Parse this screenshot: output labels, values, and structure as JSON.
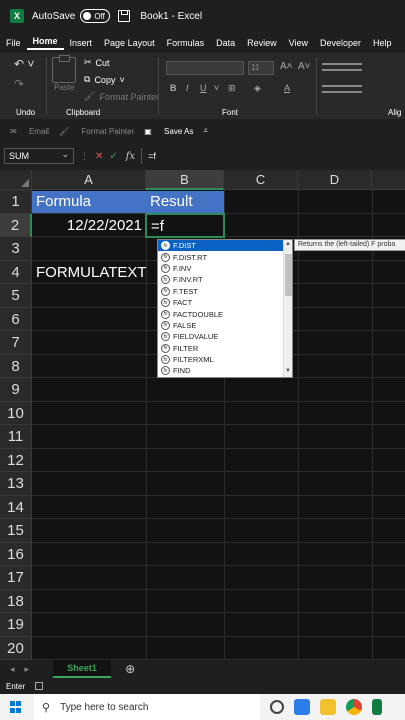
{
  "titlebar": {
    "autosave_label": "AutoSave",
    "toggle_state": "Off",
    "title": "Book1 - Excel"
  },
  "menu": [
    "File",
    "Home",
    "Insert",
    "Page Layout",
    "Formulas",
    "Data",
    "Review",
    "View",
    "Developer",
    "Help"
  ],
  "ribbon": {
    "cut": "Cut",
    "copy": "Copy",
    "format_painter": "Format Painter",
    "paste": "Paste",
    "font_size": "11",
    "groups": {
      "undo": "Undo",
      "clipboard": "Clipboard",
      "font": "Font",
      "alignment": "Alig"
    }
  },
  "quickbar": {
    "email": "Email",
    "format_painter": "Format Painter",
    "save_as": "Save As"
  },
  "formula_bar": {
    "name_box": "SUM",
    "formula": "=f",
    "fx": "fx"
  },
  "columns": [
    "A",
    "B",
    "C",
    "D"
  ],
  "rows": [
    "1",
    "2",
    "3",
    "4",
    "5",
    "6",
    "7",
    "8",
    "9",
    "10",
    "11",
    "12",
    "13",
    "14",
    "15",
    "16",
    "17",
    "18",
    "19",
    "20"
  ],
  "cells": {
    "A1": "Formula",
    "B1": "Result",
    "A2": "12/22/2021",
    "B2": "=f",
    "A4": "FORMULATEXT"
  },
  "autocomplete": {
    "items": [
      "F.DIST",
      "F.DIST.RT",
      "F.INV",
      "F.INV.RT",
      "F.TEST",
      "FACT",
      "FACTDOUBLE",
      "FALSE",
      "FIELDVALUE",
      "FILTER",
      "FILTERXML",
      "FIND"
    ],
    "tooltip": "Returns the (left-tailed) F proba"
  },
  "sheet_tab": "Sheet1",
  "status": {
    "mode": "Enter"
  },
  "taskbar": {
    "search_placeholder": "Type here to search"
  },
  "colors": {
    "header_fill": "#4472c4",
    "active_border": "#2e8b57",
    "excel_green": "#107c41"
  }
}
